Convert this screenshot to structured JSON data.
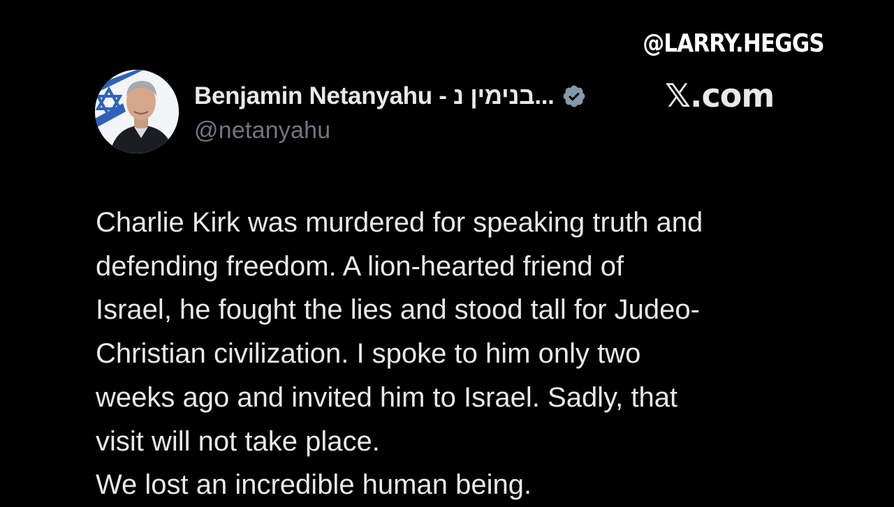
{
  "watermark": "@LARRY.HEGGS",
  "post": {
    "author": {
      "display_name": "Benjamin Netanyahu - בנימין נ...",
      "handle": "@netanyahu",
      "verified": true,
      "verified_color": "#829aab"
    },
    "site_label": "𝕏.com",
    "body_lines": [
      "Charlie Kirk was murdered for speaking truth and",
      "defending freedom. A lion-hearted friend of",
      "Israel, he fought the lies and stood tall for Judeo-",
      "Christian civilization. I spoke to him only two",
      "weeks ago and invited him to Israel. Sadly, that",
      "visit will not take place.",
      "We lost an incredible human being."
    ]
  },
  "colors": {
    "background": "#000000",
    "text_primary": "#e7e9ea",
    "text_secondary": "#71767b"
  }
}
